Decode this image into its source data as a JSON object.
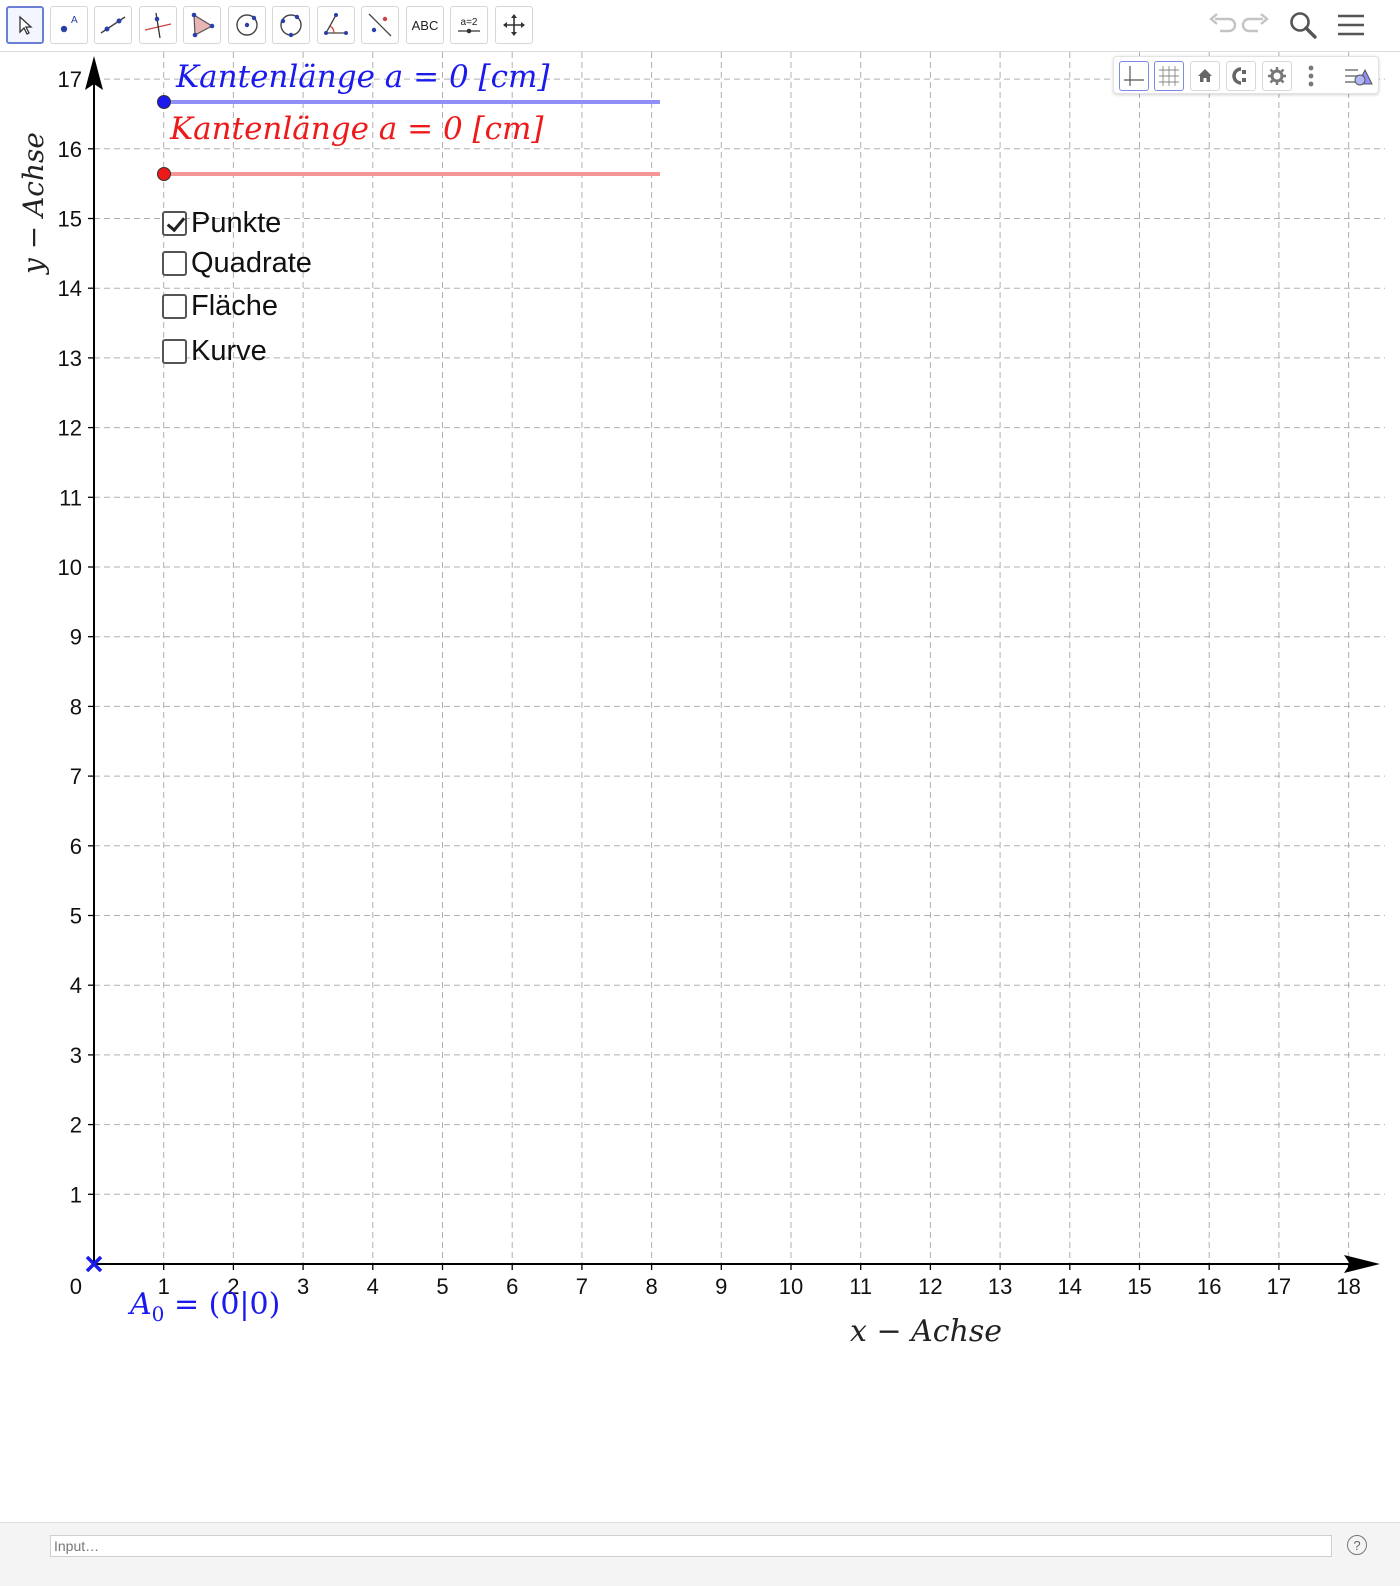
{
  "toolbar": {
    "tools": [
      {
        "name": "move-tool",
        "icon": "arrow-pointer-icon",
        "selected": true
      },
      {
        "name": "point-tool",
        "icon": "point-icon"
      },
      {
        "name": "line-tool",
        "icon": "line-icon"
      },
      {
        "name": "perpendicular-tool",
        "icon": "perpendicular-line-icon"
      },
      {
        "name": "polygon-tool",
        "icon": "polygon-icon"
      },
      {
        "name": "circle-center-tool",
        "icon": "circle-center-icon"
      },
      {
        "name": "circle-three-points-tool",
        "icon": "circle-three-points-icon"
      },
      {
        "name": "angle-tool",
        "icon": "angle-icon"
      },
      {
        "name": "reflect-tool",
        "icon": "reflect-icon"
      },
      {
        "name": "text-tool",
        "label": "ABC"
      },
      {
        "name": "slider-tool",
        "label": "a=2"
      },
      {
        "name": "move-graphics-tool",
        "icon": "move-graphics-icon"
      }
    ],
    "right": [
      "undo-icon",
      "redo-icon",
      "search-icon",
      "menu-icon"
    ]
  },
  "sliders": [
    {
      "label": "Kantenlänge a = 0 [cm]",
      "color": "#1a1aee",
      "track_color": "#8f8ff7",
      "value": 0
    },
    {
      "label": "Kantenlänge a = 0 [cm]",
      "color": "#ee1a1a",
      "track_color": "#f59595",
      "value": 0
    }
  ],
  "checkboxes": [
    {
      "label": "Punkte",
      "checked": true
    },
    {
      "label": "Quadrate",
      "checked": false
    },
    {
      "label": "Fläche",
      "checked": false
    },
    {
      "label": "Kurve",
      "checked": false
    }
  ],
  "axes": {
    "x_label": "x − Achse",
    "y_label": "y − Achse",
    "x_ticks": [
      "1",
      "2",
      "3",
      "4",
      "5",
      "6",
      "7",
      "8",
      "9",
      "10",
      "11",
      "12",
      "13",
      "14",
      "15",
      "16",
      "17",
      "18"
    ],
    "y_ticks": [
      "1",
      "2",
      "3",
      "4",
      "5",
      "6",
      "7",
      "8",
      "9",
      "10",
      "11",
      "12",
      "13",
      "14",
      "15",
      "16",
      "17"
    ],
    "origin_label": "0",
    "x_range": [
      0,
      18
    ],
    "y_range": [
      0,
      17
    ],
    "grid": true
  },
  "point": {
    "label": "A",
    "subscript": "0",
    "coords": " = (0|0)",
    "color": "#1a1aee",
    "x": 0,
    "y": 0
  },
  "stylebar": [
    "axes-toggle-icon",
    "grid-toggle-icon",
    "home-icon",
    "point-capturing-icon",
    "gear-icon",
    "more-vertical-icon",
    "style-bar-toggle-icon"
  ],
  "input": {
    "placeholder": "Input…",
    "help": "?"
  },
  "colors": {
    "axis": "#000000",
    "grid": "#b0b0b0",
    "accent": "#6b7fd6"
  }
}
